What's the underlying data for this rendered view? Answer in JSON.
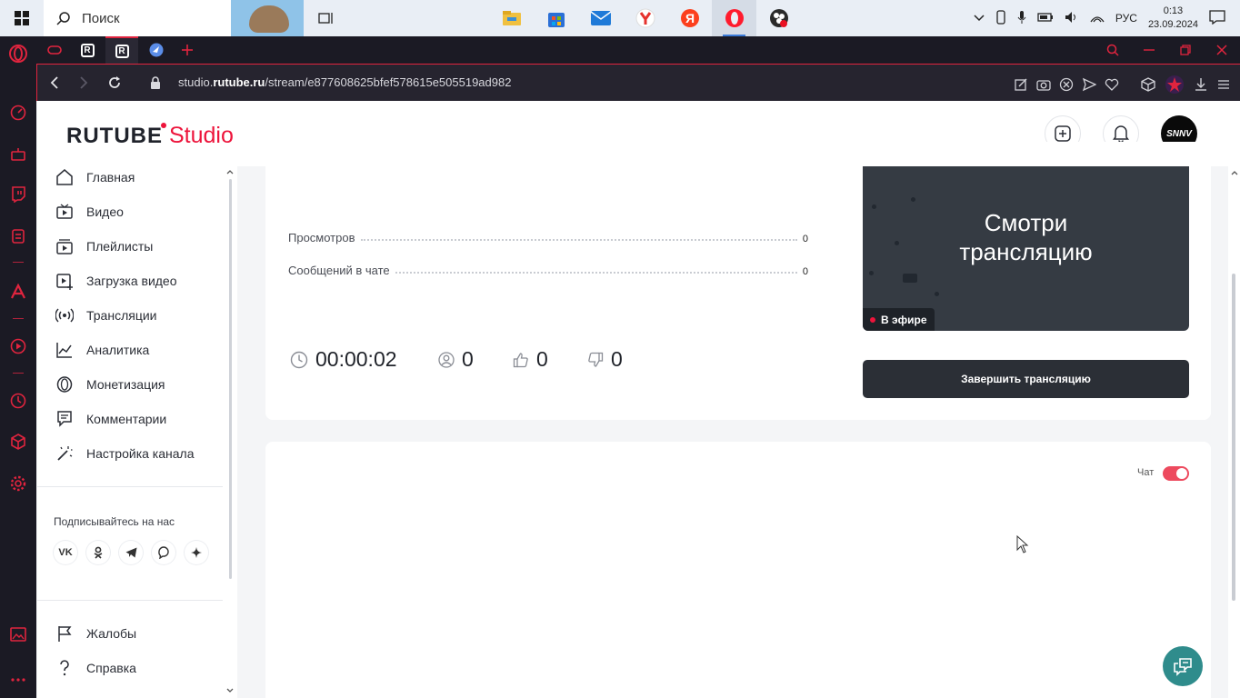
{
  "taskbar": {
    "search_placeholder": "Поиск",
    "apps": [
      "file-explorer",
      "microsoft-store",
      "mail",
      "yandex-browser",
      "yandex",
      "opera",
      "obs"
    ],
    "tray": {
      "language": "РУС",
      "time": "0:13",
      "date": "23.09.2024"
    }
  },
  "browser": {
    "url_prefix": "studio.",
    "url_domain": "rutube.ru",
    "url_path": "/stream/e877608625bfef578615e505519ad982",
    "tabs": [
      "tab-game",
      "tab-rutube",
      "tab-rutube-studio",
      "tab-bird"
    ]
  },
  "header": {
    "logo_main": "RUTUBE",
    "logo_studio": "Studio",
    "avatar_text": "SNNV"
  },
  "sidebar": {
    "items": [
      {
        "label": "Главная",
        "icon": "home-icon"
      },
      {
        "label": "Видео",
        "icon": "video-icon"
      },
      {
        "label": "Плейлисты",
        "icon": "playlist-icon"
      },
      {
        "label": "Загрузка видео",
        "icon": "upload-icon"
      },
      {
        "label": "Трансляции",
        "icon": "broadcast-icon"
      },
      {
        "label": "Аналитика",
        "icon": "analytics-icon"
      },
      {
        "label": "Монетизация",
        "icon": "coin-icon"
      },
      {
        "label": "Комментарии",
        "icon": "comments-icon"
      },
      {
        "label": "Настройка канала",
        "icon": "magic-wand-icon"
      }
    ],
    "follow_title": "Подписывайтесь на нас",
    "socials": [
      "vk",
      "ok",
      "telegram",
      "viber",
      "more"
    ],
    "footer_items": [
      {
        "label": "Жалобы",
        "icon": "flag-icon"
      },
      {
        "label": "Справка",
        "icon": "help-icon"
      }
    ]
  },
  "stream": {
    "stats": [
      {
        "label": "Просмотров",
        "value": "0"
      },
      {
        "label": "Сообщений в чате",
        "value": "0"
      }
    ],
    "preview_line1": "Смотри",
    "preview_line2": "трансляцию",
    "live_badge": "В эфире",
    "duration": "00:00:02",
    "viewers": "0",
    "likes": "0",
    "dislikes": "0",
    "end_button": "Завершить трансляцию"
  },
  "chat": {
    "label": "Чат",
    "enabled": true,
    "toggle_color": "#ed4a5e"
  },
  "colors": {
    "brand": "#ed143b",
    "dark": "#2b2f36",
    "support": "#2f8c8c"
  }
}
